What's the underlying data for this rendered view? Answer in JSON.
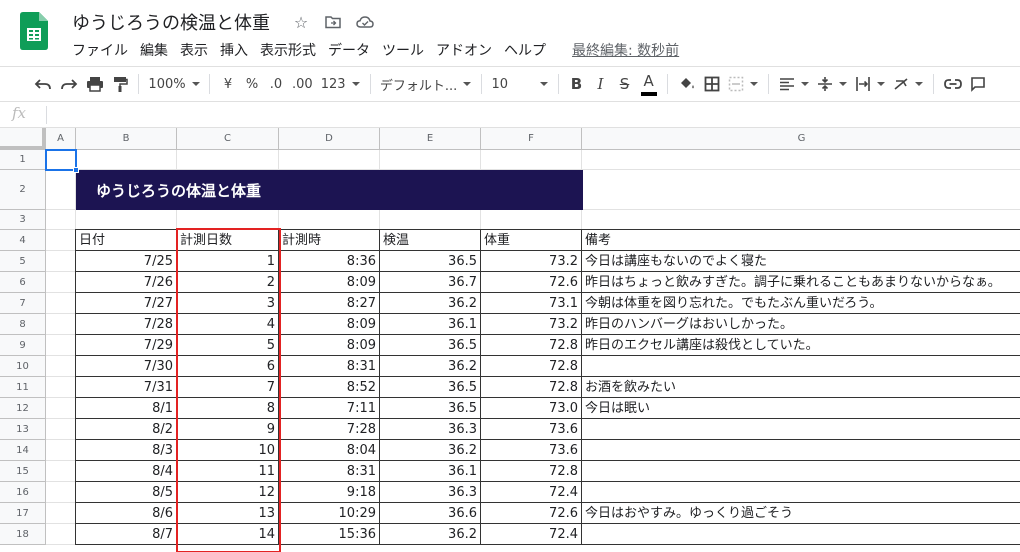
{
  "app": {
    "doc_title": "ゆうじろうの検温と体重",
    "last_edit": "最終編集: 数秒前"
  },
  "menu": [
    "ファイル",
    "編集",
    "表示",
    "挿入",
    "表示形式",
    "データ",
    "ツール",
    "アドオン",
    "ヘルプ"
  ],
  "toolbar": {
    "zoom": "100%",
    "currency": "¥",
    "percent": "%",
    "dec_decrease": ".0",
    "dec_increase": ".00",
    "number_format": "123",
    "font": "デフォルト...",
    "font_size": "10",
    "bold": "B",
    "italic": "I",
    "strike": "S",
    "text_color": "A"
  },
  "formula_bar": {
    "fx": "fx",
    "value": ""
  },
  "columns": [
    "A",
    "B",
    "C",
    "D",
    "E",
    "F",
    "G"
  ],
  "rows": [
    "1",
    "2",
    "3",
    "4",
    "5",
    "6",
    "7",
    "8",
    "9",
    "10",
    "11",
    "12",
    "13",
    "14",
    "15",
    "16",
    "17",
    "18"
  ],
  "banner_title": "ゆうじろうの体温と体重",
  "table": {
    "headers": [
      "日付",
      "計測日数",
      "計測時",
      "検温",
      "体重",
      "備考"
    ],
    "rows": [
      [
        "7/25",
        "1",
        "8:36",
        "36.5",
        "73.2",
        "今日は講座もないのでよく寝た"
      ],
      [
        "7/26",
        "2",
        "8:09",
        "36.7",
        "72.6",
        "昨日はちょっと飲みすぎた。調子に乗れることもあまりないからなぁ。"
      ],
      [
        "7/27",
        "3",
        "8:27",
        "36.2",
        "73.1",
        "今朝は体重を図り忘れた。でもたぶん重いだろう。"
      ],
      [
        "7/28",
        "4",
        "8:09",
        "36.1",
        "73.2",
        "昨日のハンバーグはおいしかった。"
      ],
      [
        "7/29",
        "5",
        "8:09",
        "36.5",
        "72.8",
        "昨日のエクセル講座は殺伐としていた。"
      ],
      [
        "7/30",
        "6",
        "8:31",
        "36.2",
        "72.8",
        ""
      ],
      [
        "7/31",
        "7",
        "8:52",
        "36.5",
        "72.8",
        "お酒を飲みたい"
      ],
      [
        "8/1",
        "8",
        "7:11",
        "36.5",
        "73.0",
        "今日は眠い"
      ],
      [
        "8/2",
        "9",
        "7:28",
        "36.3",
        "73.6",
        ""
      ],
      [
        "8/3",
        "10",
        "8:04",
        "36.2",
        "73.6",
        ""
      ],
      [
        "8/4",
        "11",
        "8:31",
        "36.1",
        "72.8",
        ""
      ],
      [
        "8/5",
        "12",
        "9:18",
        "36.3",
        "72.4",
        ""
      ],
      [
        "8/6",
        "13",
        "10:29",
        "36.6",
        "72.6",
        "今日はおやすみ。ゆっくり過ごそう"
      ],
      [
        "8/7",
        "14",
        "15:36",
        "36.2",
        "72.4",
        ""
      ]
    ]
  },
  "colors": {
    "banner_bg": "#1c1452",
    "highlight": "#e32222",
    "selection": "#1a73e8",
    "logo_green": "#0f9d58"
  }
}
